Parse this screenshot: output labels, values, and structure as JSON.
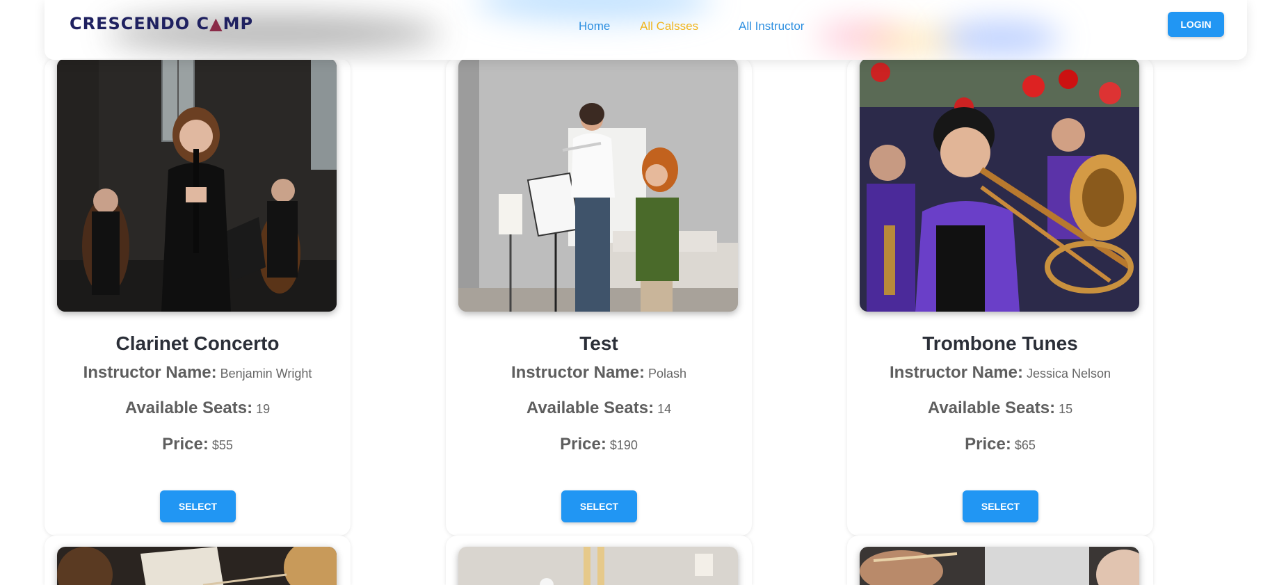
{
  "nav": {
    "logo_text_1": "CRESCENDO C",
    "logo_text_2": "MP",
    "links": [
      {
        "label": "Home"
      },
      {
        "label": "All Calsses"
      },
      {
        "label": "All Instructor"
      }
    ],
    "login_label": "LOGIN",
    "colors": {
      "link": "#2d8fe0",
      "active": "#f0b41b",
      "button": "#2196f3"
    }
  },
  "labels": {
    "instructor": "Instructor Name:",
    "seats": "Available Seats:",
    "price": "Price:",
    "select": "SELECT"
  },
  "classes": [
    {
      "title": "Clarinet Concerto",
      "instructor": "Benjamin Wright",
      "seats": "19",
      "price": "$55",
      "image": "clarinet-performance-photo"
    },
    {
      "title": "Test",
      "instructor": "Polash",
      "seats": "14",
      "price": "$190",
      "image": "flute-lesson-photo"
    },
    {
      "title": "Trombone Tunes",
      "instructor": "Jessica Nelson",
      "seats": "15",
      "price": "$65",
      "image": "trombone-child-photo"
    }
  ],
  "next_row_images": [
    "orchestra-sheet-music-photo",
    "room-lamp-photo",
    "guitar-hands-photo"
  ]
}
